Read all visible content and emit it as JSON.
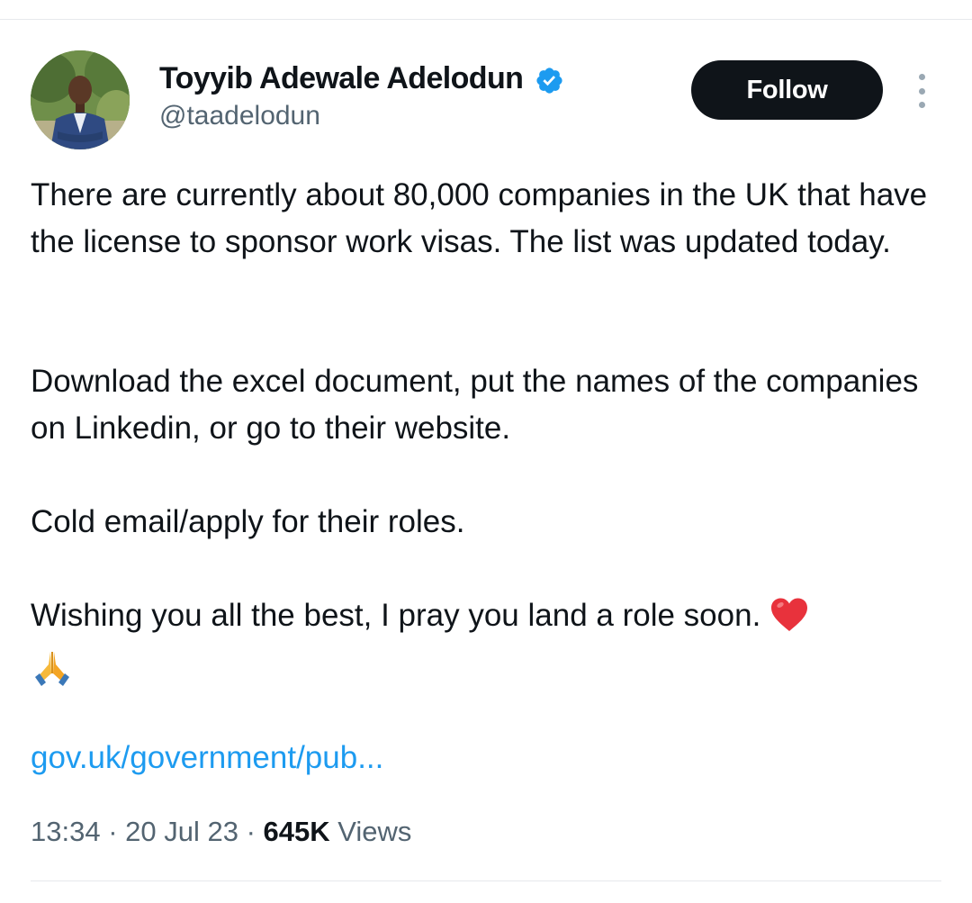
{
  "author": {
    "name": "Toyyib Adewale Adelodun",
    "handle": "@taadelodun",
    "verified": true,
    "verified_color": "#1d9bf0"
  },
  "follow_button": {
    "label": "Follow",
    "background": "#0f1419"
  },
  "more_icon": "more-vertical-dots",
  "tweet": {
    "paragraph_1": "There are currently about 80,000 companies in the UK that have the license to sponsor work visas. The list was updated today.",
    "paragraph_2": "Download the excel document, put the names of the companies on Linkedin, or go to their website.",
    "paragraph_3": "Cold email/apply for their roles.",
    "paragraph_4": "Wishing you all the best, I pray you land a role soon.",
    "emoji_heart": "red-heart-emoji",
    "emoji_pray": "folded-hands-emoji",
    "link": "gov.uk/government/pub..."
  },
  "meta": {
    "time": "13:34",
    "separator": " · ",
    "date": "20 Jul 23",
    "views_count": "645K",
    "views_label": "Views"
  },
  "colors": {
    "text": "#0f1419",
    "secondary": "#536471",
    "link": "#1d9bf0"
  }
}
